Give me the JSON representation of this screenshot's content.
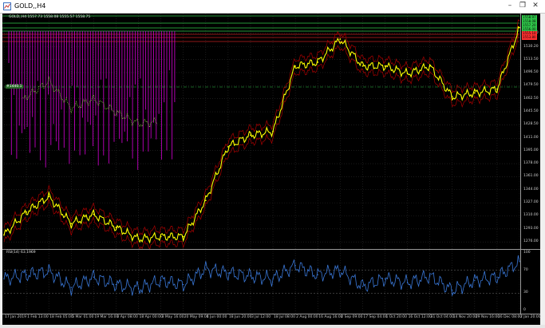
{
  "window": {
    "title": "GOLD,,H4",
    "minimize_glyph": "–",
    "restore_glyph": "❐",
    "close_glyph": "✕"
  },
  "chart": {
    "symbol_info": "GOLD,,H4  1557.73 1558.08 1555.57 1558.75",
    "hline_label": "#1440.1",
    "rsi_label": "RSI(14) 63.1969",
    "price_ticks": [
      "1547.50",
      "1530.20",
      "1513.50",
      "1496.50",
      "1479.50",
      "1462.50",
      "1445.50",
      "1428.50",
      "1411.00",
      "1395.00",
      "1378.00",
      "1361.00",
      "1344.00",
      "1327.00",
      "1310.00",
      "1293.00",
      "1276.00"
    ],
    "rsi_ticks": [
      "100",
      "70",
      "30",
      "0"
    ],
    "time_ticks": [
      "17 Jan 2019",
      "1 Feb 13:00",
      "18 Feb 05:00",
      "5 Mar 01:00",
      "19 Mar 16:00",
      "3 Apr 08:00",
      "18 Apr 00:00",
      "3 May 16:00",
      "20 May 09:00",
      "4 Jun 00:00",
      "18 Jun 20:00",
      "3 Jul 12:00",
      "18 Jul 08:00",
      "2 Aug 00:00",
      "16 Aug 16:00",
      "2 Sep 09:00",
      "17 Sep 04:00",
      "1 Oct 20:00",
      "16 Oct 12:00",
      "31 Oct 04:00",
      "14 Nov 20:00",
      "29 Nov 16:00",
      "16 Dec 08:00",
      "2 Jan 20:00"
    ],
    "badges": [
      {
        "text": "1558.97",
        "color": "#2fc84a"
      },
      {
        "text": "1558.08",
        "color": "#2fc84a"
      },
      {
        "text": "1557.20",
        "color": "#2fc84a"
      },
      {
        "text": "1556.00",
        "color": "#2fc84a"
      },
      {
        "text": "1555.10",
        "color": "#ff3030"
      },
      {
        "text": "1553.80",
        "color": "#ff3030"
      }
    ],
    "colors": {
      "background": "#000000",
      "price_line": "#ffff00",
      "envelope": "#aa0000",
      "rsi": "#3a78d8",
      "magenta": "#c000c0",
      "green_line": "#2fc84a"
    }
  },
  "chart_data": {
    "type": "line",
    "title": "GOLD,,H4",
    "x": [
      "17 Jan 2019",
      "1 Feb 13:00",
      "18 Feb 05:00",
      "5 Mar 01:00",
      "19 Mar 16:00",
      "3 Apr 08:00",
      "18 Apr 00:00",
      "3 May 16:00",
      "20 May 09:00",
      "4 Jun 00:00",
      "18 Jun 20:00",
      "3 Jul 12:00",
      "18 Jul 08:00",
      "2 Aug 00:00",
      "16 Aug 16:00",
      "2 Sep 09:00",
      "17 Sep 04:00",
      "1 Oct 20:00",
      "16 Oct 12:00",
      "31 Oct 04:00",
      "14 Nov 20:00",
      "29 Nov 16:00",
      "16 Dec 08:00",
      "2 Jan 20:00"
    ],
    "series": [
      {
        "values": [
          1285,
          1315,
          1335,
          1300,
          1312,
          1295,
          1280,
          1283,
          1283,
          1330,
          1400,
          1415,
          1420,
          1505,
          1510,
          1540,
          1505,
          1505,
          1495,
          1505,
          1465,
          1470,
          1475,
          1555
        ]
      }
    ],
    "rsi": [
      55,
      62,
      68,
      40,
      58,
      45,
      38,
      52,
      45,
      72,
      65,
      60,
      55,
      78,
      62,
      70,
      42,
      55,
      48,
      60,
      35,
      52,
      58,
      85
    ],
    "ylim": [
      1270,
      1565
    ],
    "rsi_ylim": [
      0,
      100
    ]
  }
}
